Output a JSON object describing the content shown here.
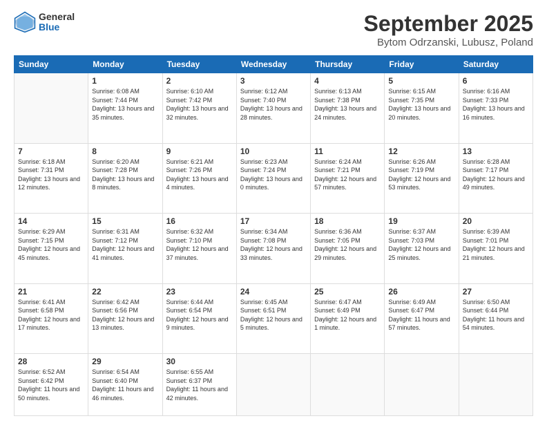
{
  "header": {
    "logo_general": "General",
    "logo_blue": "Blue",
    "month_title": "September 2025",
    "location": "Bytom Odrzanski, Lubusz, Poland"
  },
  "weekdays": [
    "Sunday",
    "Monday",
    "Tuesday",
    "Wednesday",
    "Thursday",
    "Friday",
    "Saturday"
  ],
  "weeks": [
    [
      {
        "day": "",
        "info": ""
      },
      {
        "day": "1",
        "info": "Sunrise: 6:08 AM\nSunset: 7:44 PM\nDaylight: 13 hours\nand 35 minutes."
      },
      {
        "day": "2",
        "info": "Sunrise: 6:10 AM\nSunset: 7:42 PM\nDaylight: 13 hours\nand 32 minutes."
      },
      {
        "day": "3",
        "info": "Sunrise: 6:12 AM\nSunset: 7:40 PM\nDaylight: 13 hours\nand 28 minutes."
      },
      {
        "day": "4",
        "info": "Sunrise: 6:13 AM\nSunset: 7:38 PM\nDaylight: 13 hours\nand 24 minutes."
      },
      {
        "day": "5",
        "info": "Sunrise: 6:15 AM\nSunset: 7:35 PM\nDaylight: 13 hours\nand 20 minutes."
      },
      {
        "day": "6",
        "info": "Sunrise: 6:16 AM\nSunset: 7:33 PM\nDaylight: 13 hours\nand 16 minutes."
      }
    ],
    [
      {
        "day": "7",
        "info": "Sunrise: 6:18 AM\nSunset: 7:31 PM\nDaylight: 13 hours\nand 12 minutes."
      },
      {
        "day": "8",
        "info": "Sunrise: 6:20 AM\nSunset: 7:28 PM\nDaylight: 13 hours\nand 8 minutes."
      },
      {
        "day": "9",
        "info": "Sunrise: 6:21 AM\nSunset: 7:26 PM\nDaylight: 13 hours\nand 4 minutes."
      },
      {
        "day": "10",
        "info": "Sunrise: 6:23 AM\nSunset: 7:24 PM\nDaylight: 13 hours\nand 0 minutes."
      },
      {
        "day": "11",
        "info": "Sunrise: 6:24 AM\nSunset: 7:21 PM\nDaylight: 12 hours\nand 57 minutes."
      },
      {
        "day": "12",
        "info": "Sunrise: 6:26 AM\nSunset: 7:19 PM\nDaylight: 12 hours\nand 53 minutes."
      },
      {
        "day": "13",
        "info": "Sunrise: 6:28 AM\nSunset: 7:17 PM\nDaylight: 12 hours\nand 49 minutes."
      }
    ],
    [
      {
        "day": "14",
        "info": "Sunrise: 6:29 AM\nSunset: 7:15 PM\nDaylight: 12 hours\nand 45 minutes."
      },
      {
        "day": "15",
        "info": "Sunrise: 6:31 AM\nSunset: 7:12 PM\nDaylight: 12 hours\nand 41 minutes."
      },
      {
        "day": "16",
        "info": "Sunrise: 6:32 AM\nSunset: 7:10 PM\nDaylight: 12 hours\nand 37 minutes."
      },
      {
        "day": "17",
        "info": "Sunrise: 6:34 AM\nSunset: 7:08 PM\nDaylight: 12 hours\nand 33 minutes."
      },
      {
        "day": "18",
        "info": "Sunrise: 6:36 AM\nSunset: 7:05 PM\nDaylight: 12 hours\nand 29 minutes."
      },
      {
        "day": "19",
        "info": "Sunrise: 6:37 AM\nSunset: 7:03 PM\nDaylight: 12 hours\nand 25 minutes."
      },
      {
        "day": "20",
        "info": "Sunrise: 6:39 AM\nSunset: 7:01 PM\nDaylight: 12 hours\nand 21 minutes."
      }
    ],
    [
      {
        "day": "21",
        "info": "Sunrise: 6:41 AM\nSunset: 6:58 PM\nDaylight: 12 hours\nand 17 minutes."
      },
      {
        "day": "22",
        "info": "Sunrise: 6:42 AM\nSunset: 6:56 PM\nDaylight: 12 hours\nand 13 minutes."
      },
      {
        "day": "23",
        "info": "Sunrise: 6:44 AM\nSunset: 6:54 PM\nDaylight: 12 hours\nand 9 minutes."
      },
      {
        "day": "24",
        "info": "Sunrise: 6:45 AM\nSunset: 6:51 PM\nDaylight: 12 hours\nand 5 minutes."
      },
      {
        "day": "25",
        "info": "Sunrise: 6:47 AM\nSunset: 6:49 PM\nDaylight: 12 hours\nand 1 minute."
      },
      {
        "day": "26",
        "info": "Sunrise: 6:49 AM\nSunset: 6:47 PM\nDaylight: 11 hours\nand 57 minutes."
      },
      {
        "day": "27",
        "info": "Sunrise: 6:50 AM\nSunset: 6:44 PM\nDaylight: 11 hours\nand 54 minutes."
      }
    ],
    [
      {
        "day": "28",
        "info": "Sunrise: 6:52 AM\nSunset: 6:42 PM\nDaylight: 11 hours\nand 50 minutes."
      },
      {
        "day": "29",
        "info": "Sunrise: 6:54 AM\nSunset: 6:40 PM\nDaylight: 11 hours\nand 46 minutes."
      },
      {
        "day": "30",
        "info": "Sunrise: 6:55 AM\nSunset: 6:37 PM\nDaylight: 11 hours\nand 42 minutes."
      },
      {
        "day": "",
        "info": ""
      },
      {
        "day": "",
        "info": ""
      },
      {
        "day": "",
        "info": ""
      },
      {
        "day": "",
        "info": ""
      }
    ]
  ]
}
